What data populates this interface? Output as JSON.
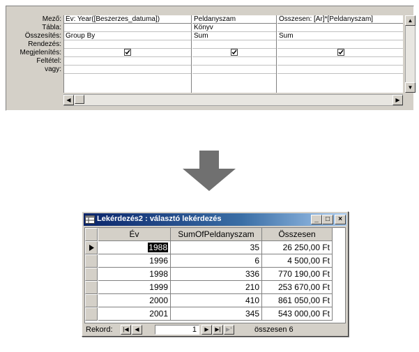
{
  "query_design": {
    "row_labels": [
      "Mező:",
      "Tábla:",
      "Összesítés:",
      "Rendezés:",
      "Megjelenítés:",
      "Feltétel:",
      "vagy:"
    ],
    "columns": [
      {
        "field": "Év: Year([Beszerzes_datuma])",
        "table": "",
        "total": "Group By",
        "sort": "",
        "show": true,
        "criteria": "",
        "or": ""
      },
      {
        "field": "Peldanyszam",
        "table": "Könyv",
        "total": "Sum",
        "sort": "",
        "show": true,
        "criteria": "",
        "or": ""
      },
      {
        "field": "Összesen: [Ar]*[Peldanyszam]",
        "table": "",
        "total": "Sum",
        "sort": "",
        "show": true,
        "criteria": "",
        "or": ""
      }
    ]
  },
  "window": {
    "title": "Lekérdezés2 : választó lekérdezés",
    "buttons": {
      "minimize": "_",
      "maximize": "□",
      "close": "×"
    }
  },
  "datasheet": {
    "headers": [
      "Év",
      "SumOfPeldanyszam",
      "Összesen"
    ],
    "rows": [
      [
        "1988",
        "35",
        "26 250,00 Ft"
      ],
      [
        "1996",
        "6",
        "4 500,00 Ft"
      ],
      [
        "1998",
        "336",
        "770 190,00 Ft"
      ],
      [
        "1999",
        "210",
        "253 670,00 Ft"
      ],
      [
        "2000",
        "410",
        "861 050,00 Ft"
      ],
      [
        "2001",
        "345",
        "543 000,00 Ft"
      ]
    ]
  },
  "navigation": {
    "label": "Rekord:",
    "current": "1",
    "total_text": "összesen 6"
  },
  "colors": {
    "titlebar_start": "#0a246a",
    "titlebar_end": "#a6caf0",
    "arrow": "#707070",
    "face": "#d4d0c8"
  }
}
